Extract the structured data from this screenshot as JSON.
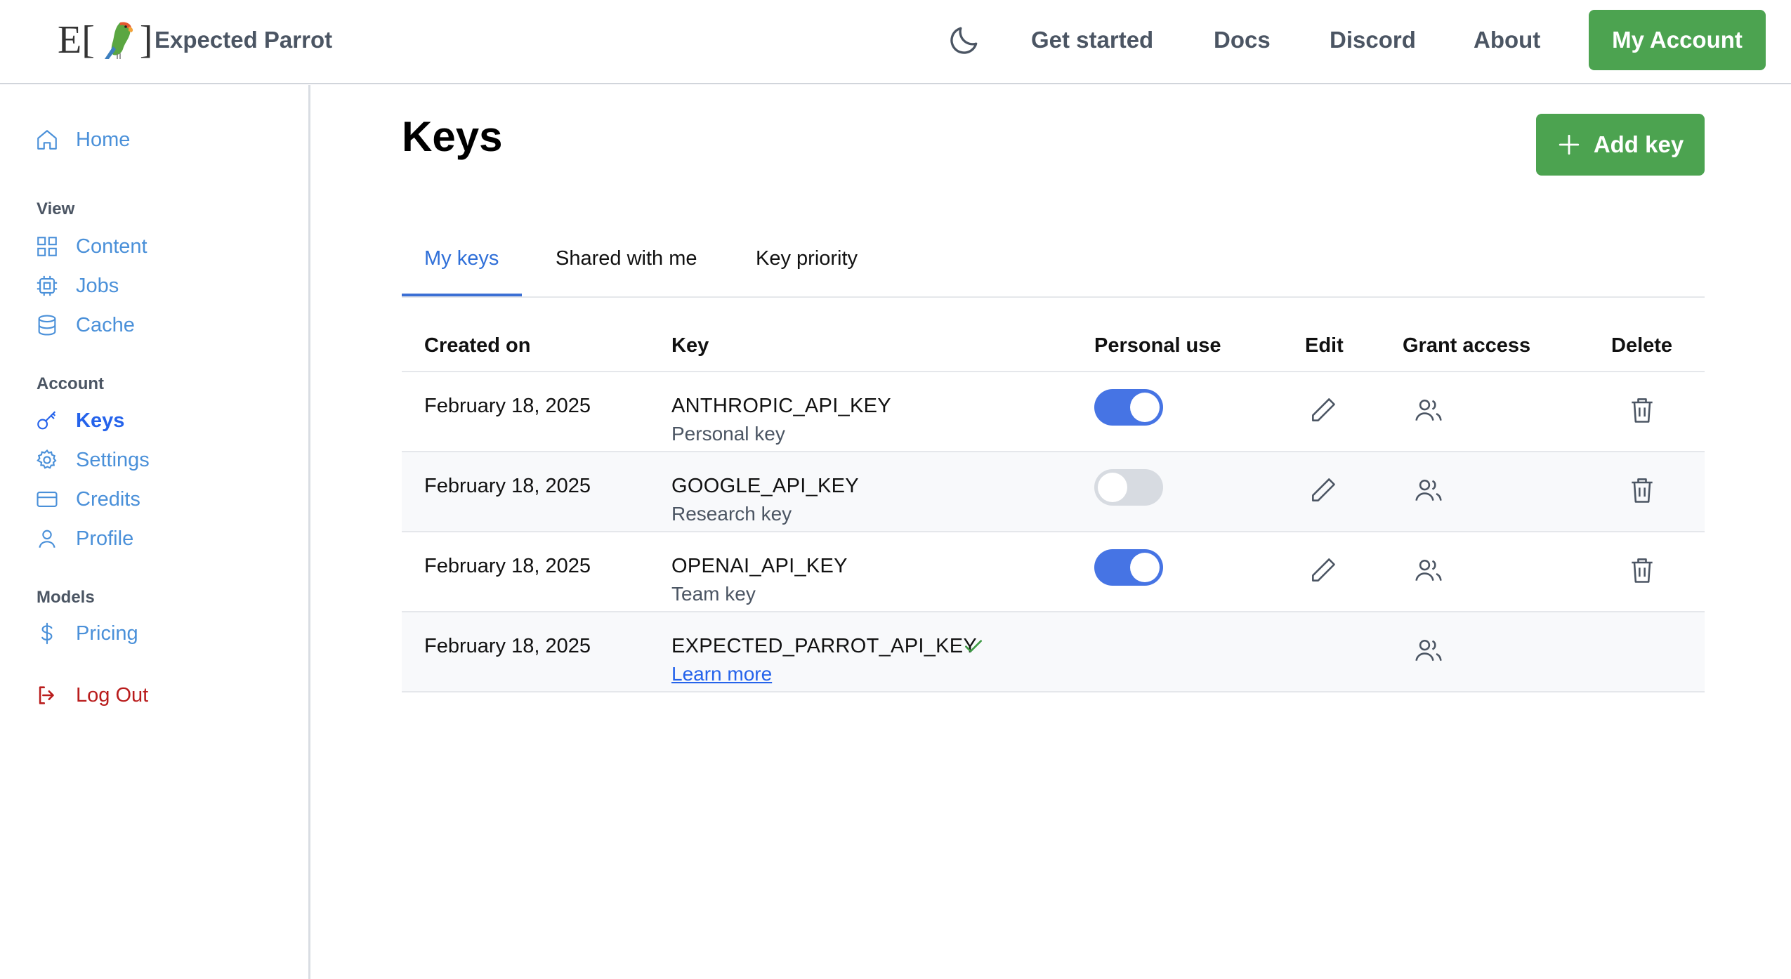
{
  "header": {
    "brand": "Expected Parrot",
    "logo_text_left": "E[",
    "logo_text_right": "]",
    "nav": [
      "Get started",
      "Docs",
      "Discord",
      "About"
    ],
    "account_button": "My Account"
  },
  "sidebar": {
    "home": "Home",
    "view_heading": "View",
    "view_items": [
      "Content",
      "Jobs",
      "Cache"
    ],
    "account_heading": "Account",
    "account_items": [
      "Keys",
      "Settings",
      "Credits",
      "Profile"
    ],
    "models_heading": "Models",
    "models_items": [
      "Pricing"
    ],
    "logout": "Log Out",
    "active": "Keys"
  },
  "main": {
    "title": "Keys",
    "add_button": "Add key",
    "tabs": [
      "My keys",
      "Shared with me",
      "Key priority"
    ],
    "active_tab": "My keys",
    "columns": [
      "Created on",
      "Key",
      "Personal use",
      "Edit",
      "Grant access",
      "Delete"
    ],
    "rows": [
      {
        "created": "February 18, 2025",
        "key": "ANTHROPIC_API_KEY",
        "desc": "Personal key",
        "personal_use": true
      },
      {
        "created": "February 18, 2025",
        "key": "GOOGLE_API_KEY",
        "desc": "Research key",
        "personal_use": false
      },
      {
        "created": "February 18, 2025",
        "key": "OPENAI_API_KEY",
        "desc": "Team key",
        "personal_use": true
      },
      {
        "created": "February 18, 2025",
        "key": "EXPECTED_PARROT_API_KEY",
        "link": "Learn more",
        "verified": true
      }
    ]
  },
  "colors": {
    "primary_green": "#4ca350",
    "link_blue": "#4a90d9",
    "active_blue": "#2563eb",
    "toggle_on": "#4674e4",
    "logout_red": "#b91c1c"
  }
}
